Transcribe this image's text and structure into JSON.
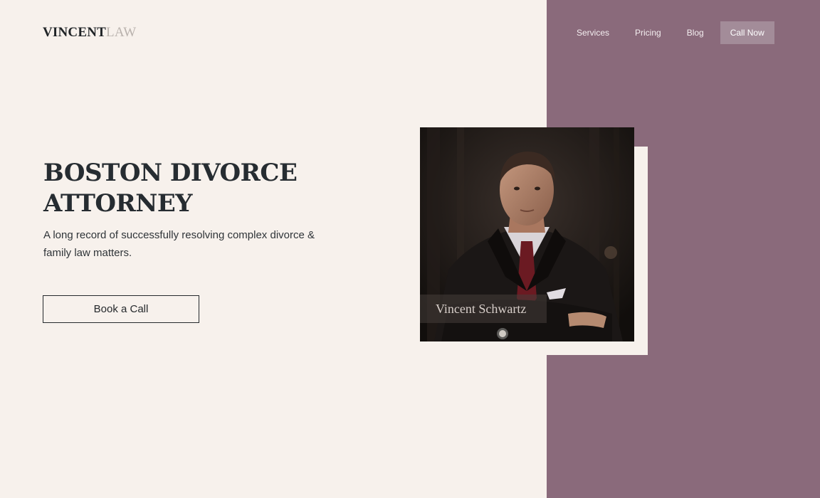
{
  "brand": {
    "logo_main": "VINCENT",
    "logo_sub": "LAW"
  },
  "nav": {
    "items": [
      {
        "label": "Services"
      },
      {
        "label": "Pricing"
      },
      {
        "label": "Blog"
      }
    ],
    "cta_label": "Call Now"
  },
  "hero": {
    "title_line1": "BOSTON DIVORCE",
    "title_line2": "ATTORNEY",
    "subtitle": "A long record of successfully resolving complex divorce & family law matters.",
    "button_label": "Book a Call"
  },
  "portrait": {
    "caption": "Vincent Schwartz"
  },
  "colors": {
    "background": "#f7f1ec",
    "panel": "#8a6a7b",
    "nav_cta": "#a38c99",
    "text_dark": "#262c31"
  }
}
